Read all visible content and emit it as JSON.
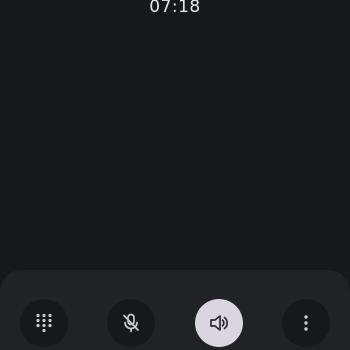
{
  "call": {
    "timer": "07:18"
  },
  "controls": [
    {
      "name": "keypad",
      "icon": "dialpad-icon",
      "active": false
    },
    {
      "name": "mute",
      "icon": "mic-off-icon",
      "active": false
    },
    {
      "name": "speaker",
      "icon": "volume-up-icon",
      "active": true
    },
    {
      "name": "more",
      "icon": "more-vert-icon",
      "active": false
    }
  ],
  "colors": {
    "background": "#17181c",
    "panel": "#212226",
    "icon": "#c9c9cf",
    "active_button": "#d9d6e0",
    "active_icon": "#2a2a30"
  }
}
